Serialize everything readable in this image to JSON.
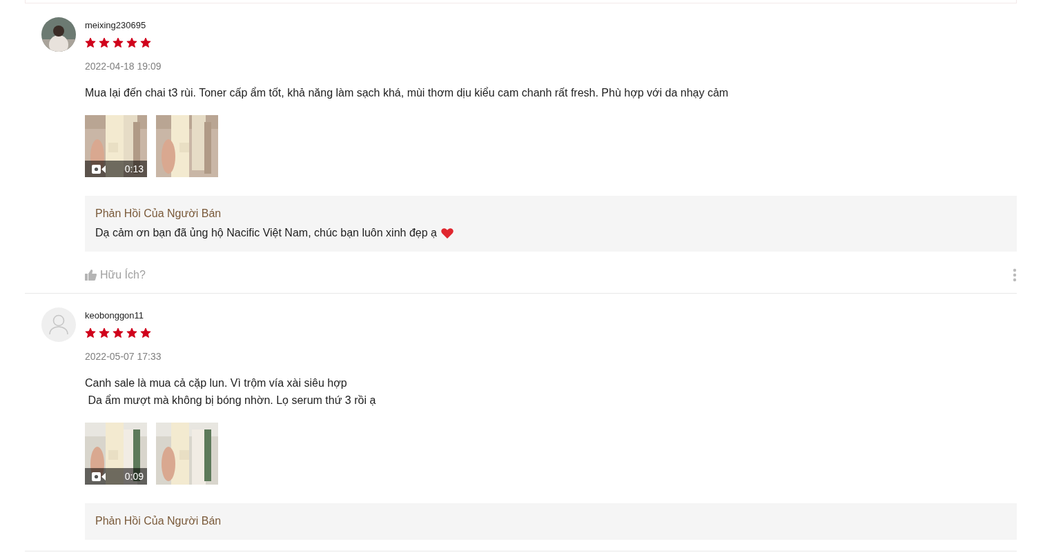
{
  "reviews": [
    {
      "username": "meixing230695",
      "avatar": {
        "kind": "picture"
      },
      "stars": 5,
      "date": "2022-04-18 19:09",
      "text": "Mua lại đến chai t3 rùi. Toner cấp ẩm tốt, khả năng làm sạch khá, mùi thơm dịu kiểu cam chanh rất fresh. Phù hợp với da nhạy cảm",
      "media": [
        {
          "kind": "video",
          "duration": "0:13"
        },
        {
          "kind": "picture"
        }
      ],
      "seller_reply": {
        "title": "Phản Hồi Của Người Bán",
        "text": "Dạ cảm ơn bạn đã ủng hộ Nacific Việt Nam, chúc bạn luôn xinh đẹp ạ"
      },
      "helpful": "Hữu Ích?"
    },
    {
      "username": "keobonggon11",
      "avatar": {
        "kind": "default"
      },
      "stars": 5,
      "date": "2022-05-07 17:33",
      "text": "Canh sale là mua cả cặp lun. Vì trộm vía xài siêu hợp\n Da ẩm mượt mà không bị bóng nhờn. Lọ serum thứ 3 rồi ạ",
      "media": [
        {
          "kind": "video",
          "duration": "0:09"
        },
        {
          "kind": "picture"
        }
      ],
      "seller_reply": {
        "title": "Phản Hồi Của Người Bán"
      }
    }
  ]
}
